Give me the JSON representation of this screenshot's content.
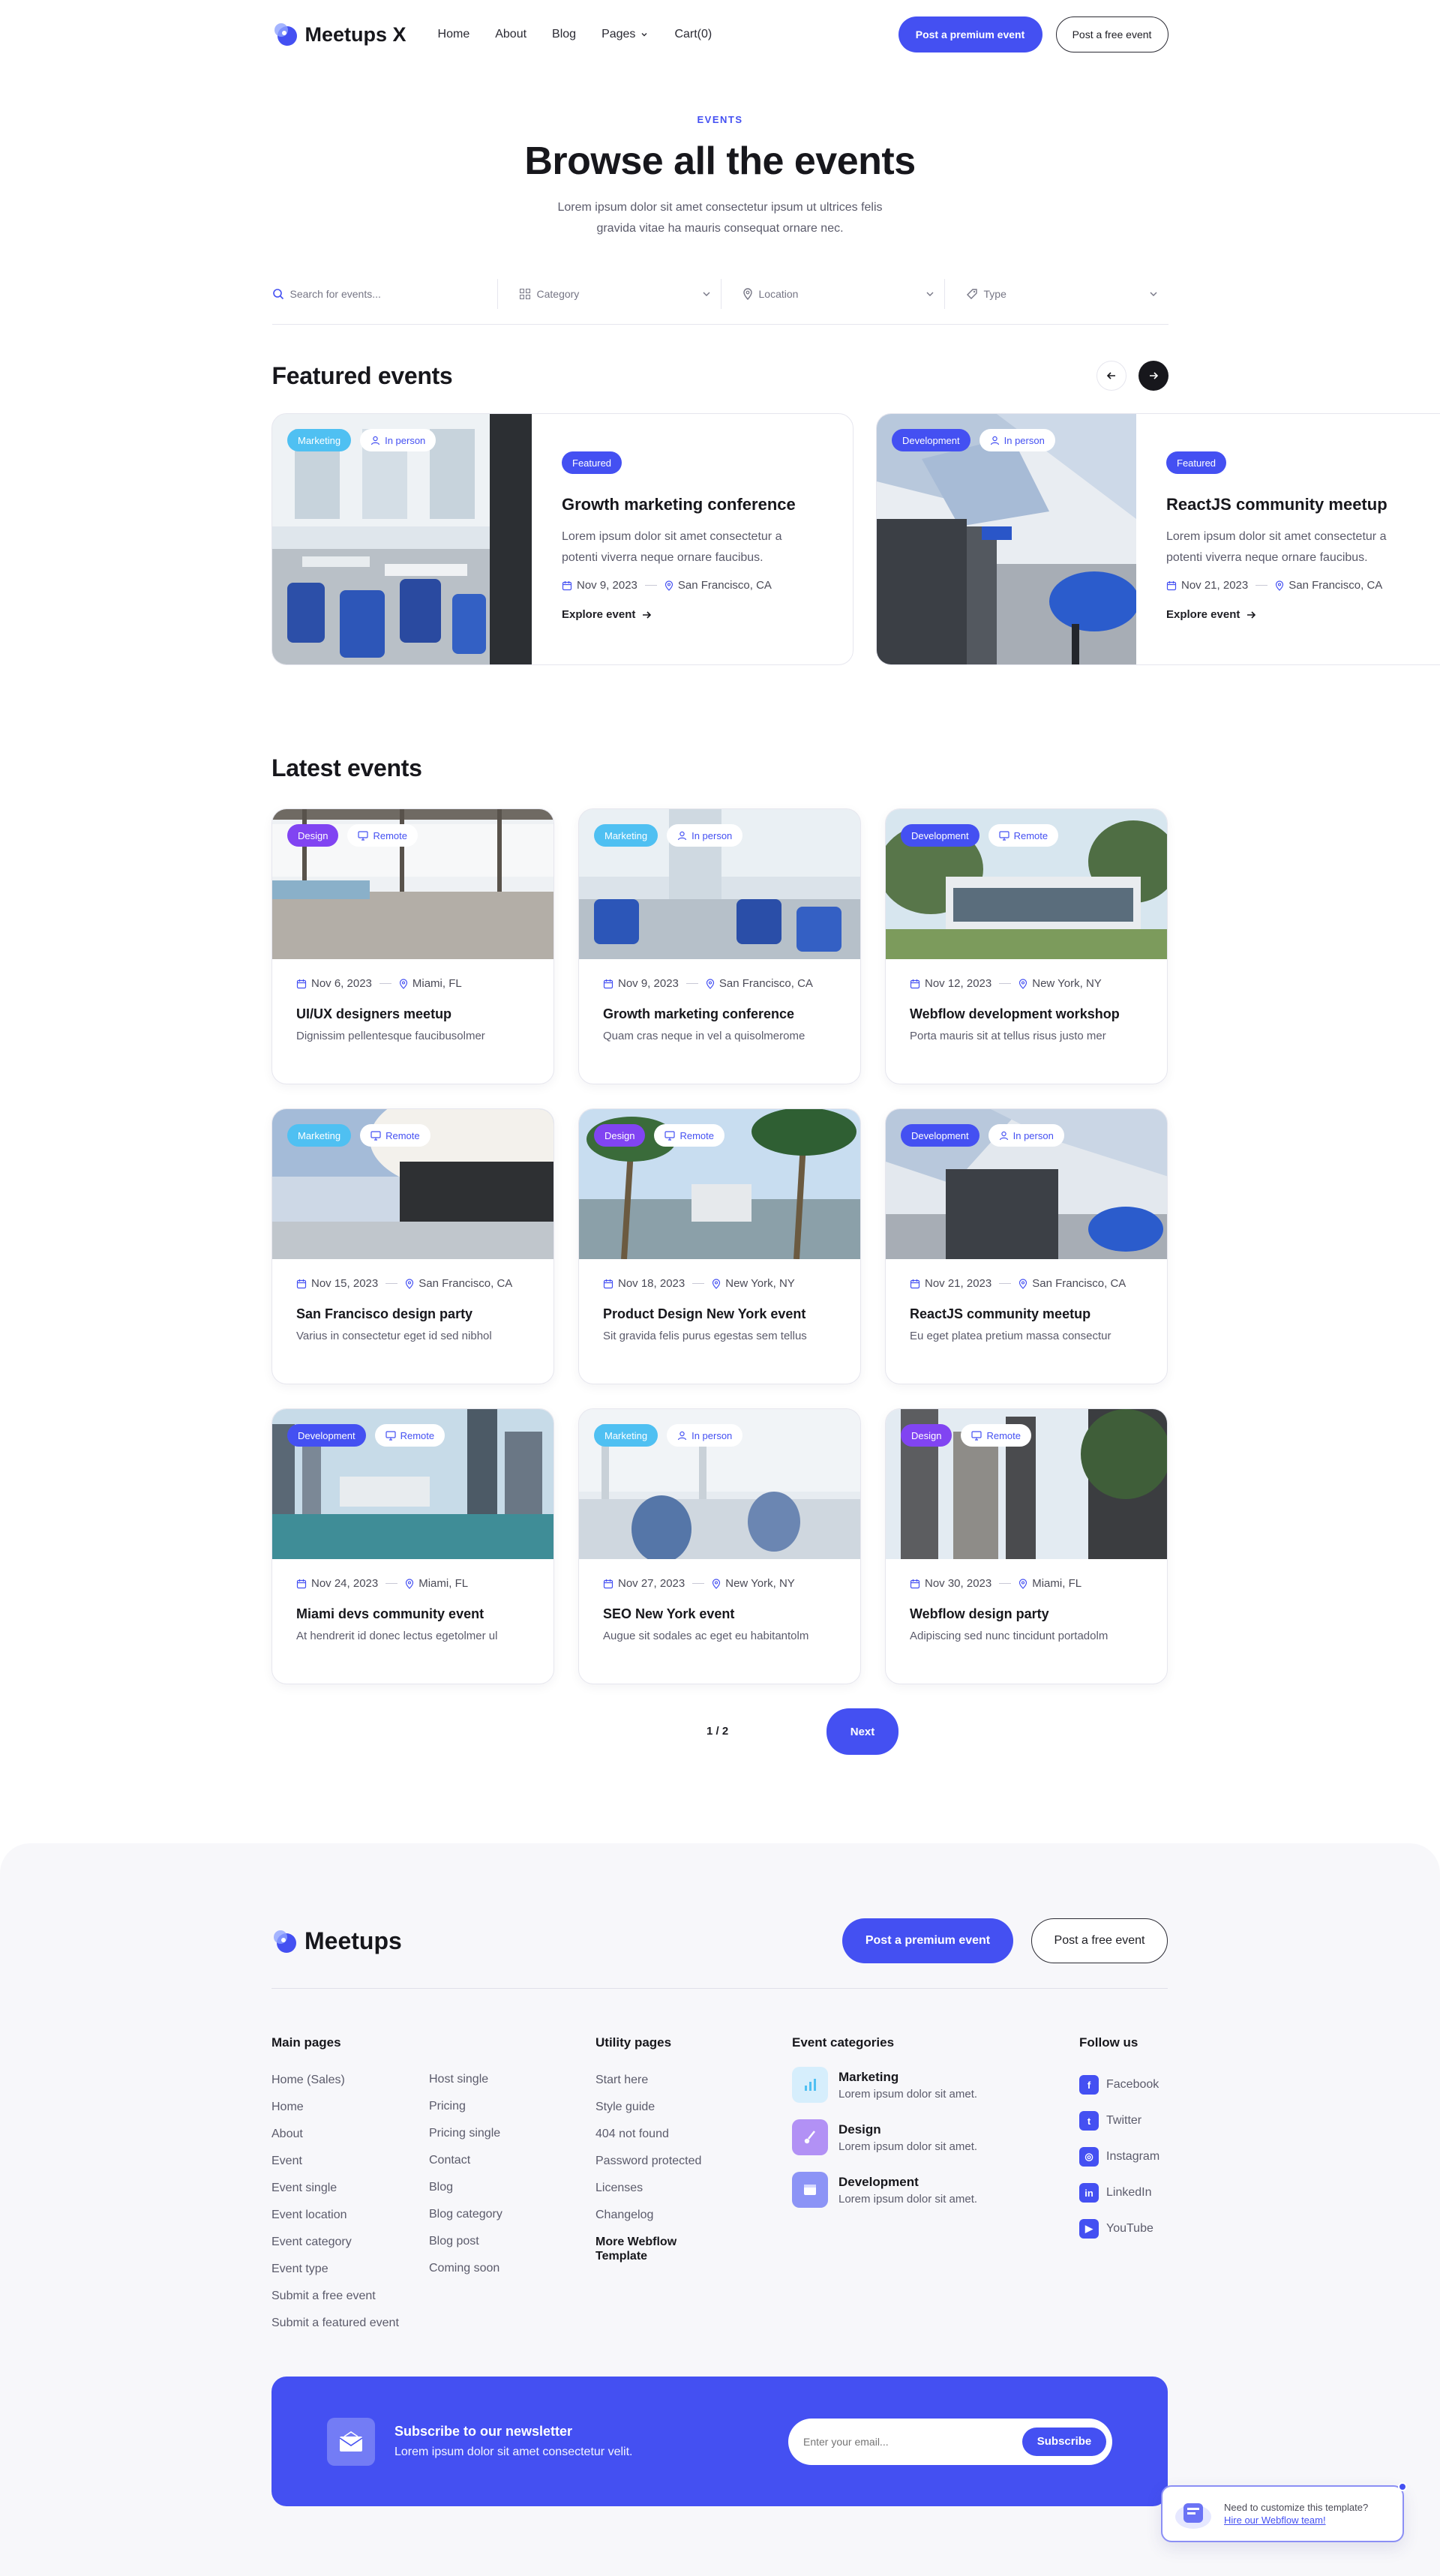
{
  "brand": {
    "name": "Meetups X",
    "accent": "#4450f2",
    "marketing_color": "#4fc0f2",
    "design_color": "#8144f2"
  },
  "nav": {
    "home": "Home",
    "about": "About",
    "blog": "Blog",
    "pages": "Pages",
    "cart": "Cart(0)"
  },
  "header_actions": {
    "premium": "Post a premium event",
    "free": "Post a free event"
  },
  "hero": {
    "eyebrow": "EVENTS",
    "title": "Browse all the events",
    "description": "Lorem ipsum dolor sit amet consectetur ipsum ut ultrices felis gravida vitae ha mauris consequat ornare nec."
  },
  "filters": {
    "search_placeholder": "Search for events...",
    "category": "Category",
    "location": "Location",
    "type": "Type"
  },
  "featured": {
    "title": "Featured events",
    "badge": "Featured",
    "explore": "Explore event",
    "items": [
      {
        "category": "Marketing",
        "mode": "In person",
        "title": "Growth marketing conference",
        "description": "Lorem ipsum dolor sit amet consectetur a potenti viverra neque ornare faucibus.",
        "date": "Nov 9, 2023",
        "location": "San Francisco, CA"
      },
      {
        "category": "Development",
        "mode": "In person",
        "title": "ReactJS community meetup",
        "description": "Lorem ipsum dolor sit amet consectetur a potenti viverra neque ornare faucibus.",
        "date": "Nov 21, 2023",
        "location": "San Francisco, CA"
      }
    ]
  },
  "latest": {
    "title": "Latest events",
    "items": [
      {
        "category": "Design",
        "mode": "Remote",
        "date": "Nov 6, 2023",
        "location": "Miami, FL",
        "title": "UI/UX designers meetup",
        "description": "Dignissim pellentesque faucibusolmer"
      },
      {
        "category": "Marketing",
        "mode": "In person",
        "date": "Nov 9, 2023",
        "location": "San Francisco, CA",
        "title": "Growth marketing conference",
        "description": "Quam cras neque in vel a quisolmerome"
      },
      {
        "category": "Development",
        "mode": "Remote",
        "date": "Nov 12, 2023",
        "location": "New York, NY",
        "title": "Webflow development workshop",
        "description": "Porta mauris sit at tellus risus justo mer"
      },
      {
        "category": "Marketing",
        "mode": "Remote",
        "date": "Nov 15, 2023",
        "location": "San Francisco, CA",
        "title": "San Francisco design party",
        "description": "Varius in consectetur eget id sed nibhol"
      },
      {
        "category": "Design",
        "mode": "Remote",
        "date": "Nov 18, 2023",
        "location": "New York, NY",
        "title": "Product Design New York event",
        "description": "Sit gravida felis purus egestas sem tellus"
      },
      {
        "category": "Development",
        "mode": "In person",
        "date": "Nov 21, 2023",
        "location": "San Francisco, CA",
        "title": "ReactJS community meetup",
        "description": "Eu eget platea pretium massa consectur"
      },
      {
        "category": "Development",
        "mode": "Remote",
        "date": "Nov 24, 2023",
        "location": "Miami, FL",
        "title": "Miami devs community event",
        "description": "At hendrerit id donec lectus egetolmer ul"
      },
      {
        "category": "Marketing",
        "mode": "In person",
        "date": "Nov 27, 2023",
        "location": "New York, NY",
        "title": "SEO New York event",
        "description": "Augue sit sodales ac eget eu habitantolm"
      },
      {
        "category": "Design",
        "mode": "Remote",
        "date": "Nov 30, 2023",
        "location": "Miami, FL",
        "title": "Webflow design party",
        "description": "Adipiscing sed nunc tincidunt portadolm"
      }
    ]
  },
  "pagination": {
    "count": "1 / 2",
    "next": "Next"
  },
  "footer": {
    "brand": "Meetups",
    "premium": "Post a premium event",
    "free": "Post a free event",
    "main_pages": {
      "title": "Main pages",
      "col1": [
        "Home (Sales)",
        "Home",
        "About",
        "Event",
        "Event single",
        "Event location",
        "Event category",
        "Event type",
        "Submit a free event",
        "Submit a featured event"
      ],
      "col2": [
        "Host single",
        "Pricing",
        "Pricing single",
        "Contact",
        "Blog",
        "Blog category",
        "Blog post",
        "Coming soon"
      ]
    },
    "utility": {
      "title": "Utility pages",
      "links": [
        "Start here",
        "Style guide",
        "404 not found",
        "Password protected",
        "Licenses",
        "Changelog"
      ],
      "more": "More Webflow Template"
    },
    "categories": {
      "title": "Event categories",
      "items": [
        {
          "name": "Marketing",
          "description": "Lorem ipsum dolor sit amet."
        },
        {
          "name": "Design",
          "description": "Lorem ipsum dolor sit amet."
        },
        {
          "name": "Development",
          "description": "Lorem ipsum dolor sit amet."
        }
      ]
    },
    "follow": {
      "title": "Follow us",
      "items": [
        "Facebook",
        "Twitter",
        "Instagram",
        "LinkedIn",
        "YouTube"
      ]
    }
  },
  "newsletter": {
    "title": "Subscribe to our newsletter",
    "description": "Lorem ipsum dolor sit amet consectetur velit.",
    "placeholder": "Enter your email...",
    "button": "Subscribe"
  },
  "customize": {
    "text": "Need to customize this template?",
    "link": "Hire our Webflow team!"
  }
}
